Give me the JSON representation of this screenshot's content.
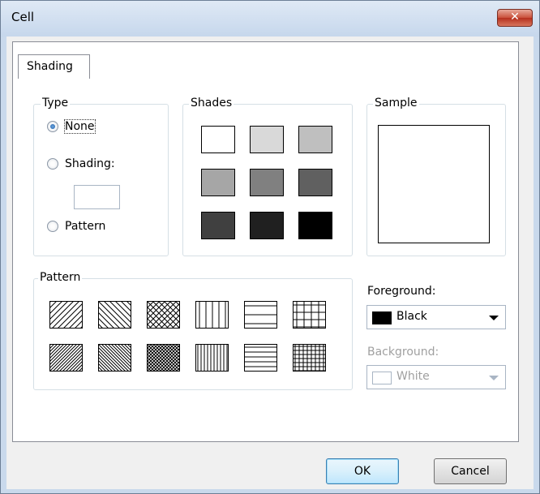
{
  "window": {
    "title": "Cell",
    "close_glyph": "✕"
  },
  "tabs": [
    {
      "label": "Shading"
    }
  ],
  "type_group": {
    "legend": "Type",
    "options": [
      {
        "label": "None",
        "checked": true
      },
      {
        "label": "Shading:",
        "checked": false
      },
      {
        "label": "Pattern",
        "checked": false
      }
    ]
  },
  "shades_group": {
    "legend": "Shades",
    "colors": [
      "#ffffff",
      "#d9d9d9",
      "#bfbfbf",
      "#a6a6a6",
      "#808080",
      "#606060",
      "#404040",
      "#202020",
      "#000000"
    ]
  },
  "sample_group": {
    "legend": "Sample"
  },
  "pattern_group": {
    "legend": "Pattern",
    "patterns": [
      "diagonal-up",
      "diagonal-down",
      "diagonal-cross",
      "vertical",
      "horizontal",
      "grid",
      "dense-diagonal-up",
      "dense-diagonal-down",
      "dense-diagonal-cross",
      "dense-vertical",
      "dense-horizontal",
      "dense-grid"
    ]
  },
  "foreground": {
    "label": "Foreground:",
    "value": "Black",
    "color": "#000000"
  },
  "background": {
    "label": "Background:",
    "value": "White",
    "color": "#ffffff"
  },
  "buttons": {
    "ok": "OK",
    "cancel": "Cancel"
  }
}
